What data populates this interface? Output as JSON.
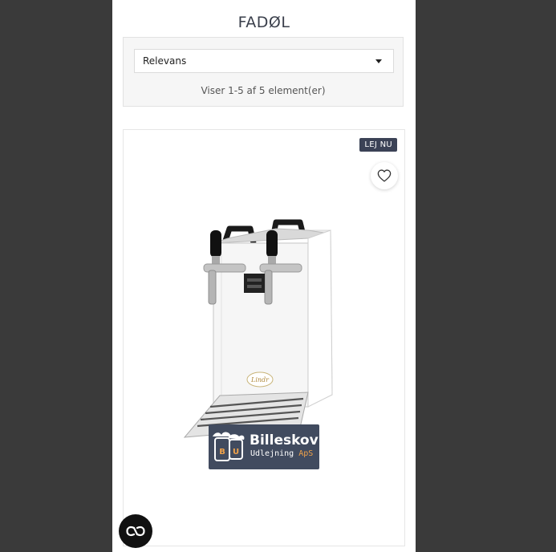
{
  "page": {
    "title": "FADØL"
  },
  "sort": {
    "selected": "Relevans",
    "result_count": "Viser 1-5 af 5 element(er)"
  },
  "product": {
    "badge": "LEJ NU",
    "image_label": "Lindr",
    "logo": {
      "name": "Billeskov",
      "sub_main": "Udlejning ",
      "sub_accent": "ApS"
    }
  },
  "icons": {
    "favorite": "heart-icon",
    "dropdown": "caret-down-icon",
    "chat": "accessibility-icon"
  },
  "colors": {
    "badge_bg": "#3b4256",
    "logo_bg": "#414b5f",
    "logo_accent": "#f0a24a",
    "outer_bg": "#3a3a3a"
  }
}
